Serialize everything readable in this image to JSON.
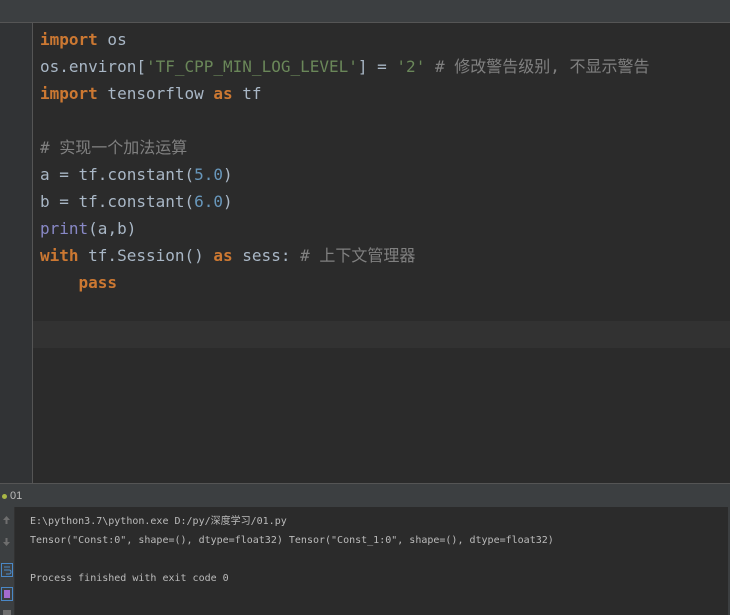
{
  "editor": {
    "lines": [
      [
        {
          "t": "import",
          "c": "kw"
        },
        {
          "t": " os",
          "c": "fn"
        }
      ],
      [
        {
          "t": "os.environ[",
          "c": "fn"
        },
        {
          "t": "'TF_CPP_MIN_LOG_LEVEL'",
          "c": "str"
        },
        {
          "t": "] = ",
          "c": "fn"
        },
        {
          "t": "'2'",
          "c": "str"
        },
        {
          "t": " # 修改警告级别, 不显示警告",
          "c": "comment"
        }
      ],
      [
        {
          "t": "import",
          "c": "kw"
        },
        {
          "t": " tensorflow ",
          "c": "fn"
        },
        {
          "t": "as",
          "c": "kw"
        },
        {
          "t": " tf",
          "c": "fn"
        }
      ],
      [],
      [
        {
          "t": "# 实现一个加法运算",
          "c": "comment"
        }
      ],
      [
        {
          "t": "a = tf.constant(",
          "c": "fn"
        },
        {
          "t": "5.0",
          "c": "num"
        },
        {
          "t": ")",
          "c": "fn"
        }
      ],
      [
        {
          "t": "b = tf.constant(",
          "c": "fn"
        },
        {
          "t": "6.0",
          "c": "num"
        },
        {
          "t": ")",
          "c": "fn"
        }
      ],
      [
        {
          "t": "print",
          "c": "builtin"
        },
        {
          "t": "(a,b)",
          "c": "fn"
        }
      ],
      [
        {
          "t": "with",
          "c": "kw"
        },
        {
          "t": " tf.Session() ",
          "c": "fn"
        },
        {
          "t": "as",
          "c": "kw"
        },
        {
          "t": " sess: ",
          "c": "fn"
        },
        {
          "t": "# 上下文管理器",
          "c": "comment"
        }
      ],
      [
        {
          "t": "    ",
          "c": "fn"
        },
        {
          "t": "pass",
          "c": "kw"
        }
      ],
      [],
      []
    ]
  },
  "run_panel": {
    "tab_label": "01"
  },
  "console": {
    "lines": [
      "E:\\python3.7\\python.exe D:/py/深度学习/01.py",
      "Tensor(\"Const:0\", shape=(), dtype=float32) Tensor(\"Const_1:0\", shape=(), dtype=float32)",
      "",
      "Process finished with exit code 0"
    ]
  },
  "icons": {
    "up": "arrow-up-icon",
    "down": "arrow-down-icon",
    "wrap": "soft-wrap-icon",
    "print": "print-icon",
    "clear": "clear-icon"
  }
}
